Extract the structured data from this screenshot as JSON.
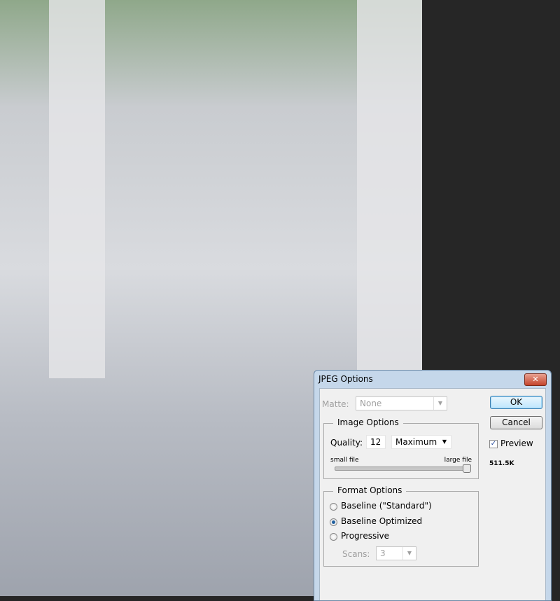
{
  "dialog": {
    "title": "JPEG Options",
    "close_label": "✕",
    "matte_label": "Matte:",
    "matte_value": "None",
    "image_options": {
      "legend": "Image Options",
      "quality_label": "Quality:",
      "quality_value": "12",
      "quality_preset": "Maximum",
      "small_file_label": "small file",
      "large_file_label": "large file",
      "quality_fraction": 1.0
    },
    "format_options": {
      "legend": "Format Options",
      "options": [
        "Baseline (\"Standard\")",
        "Baseline Optimized",
        "Progressive"
      ],
      "selected_index": 1,
      "scans_label": "Scans:",
      "scans_value": "3"
    },
    "ok_label": "OK",
    "cancel_label": "Cancel",
    "preview_label": "Preview",
    "preview_checked": true,
    "file_size": "511.5K"
  }
}
